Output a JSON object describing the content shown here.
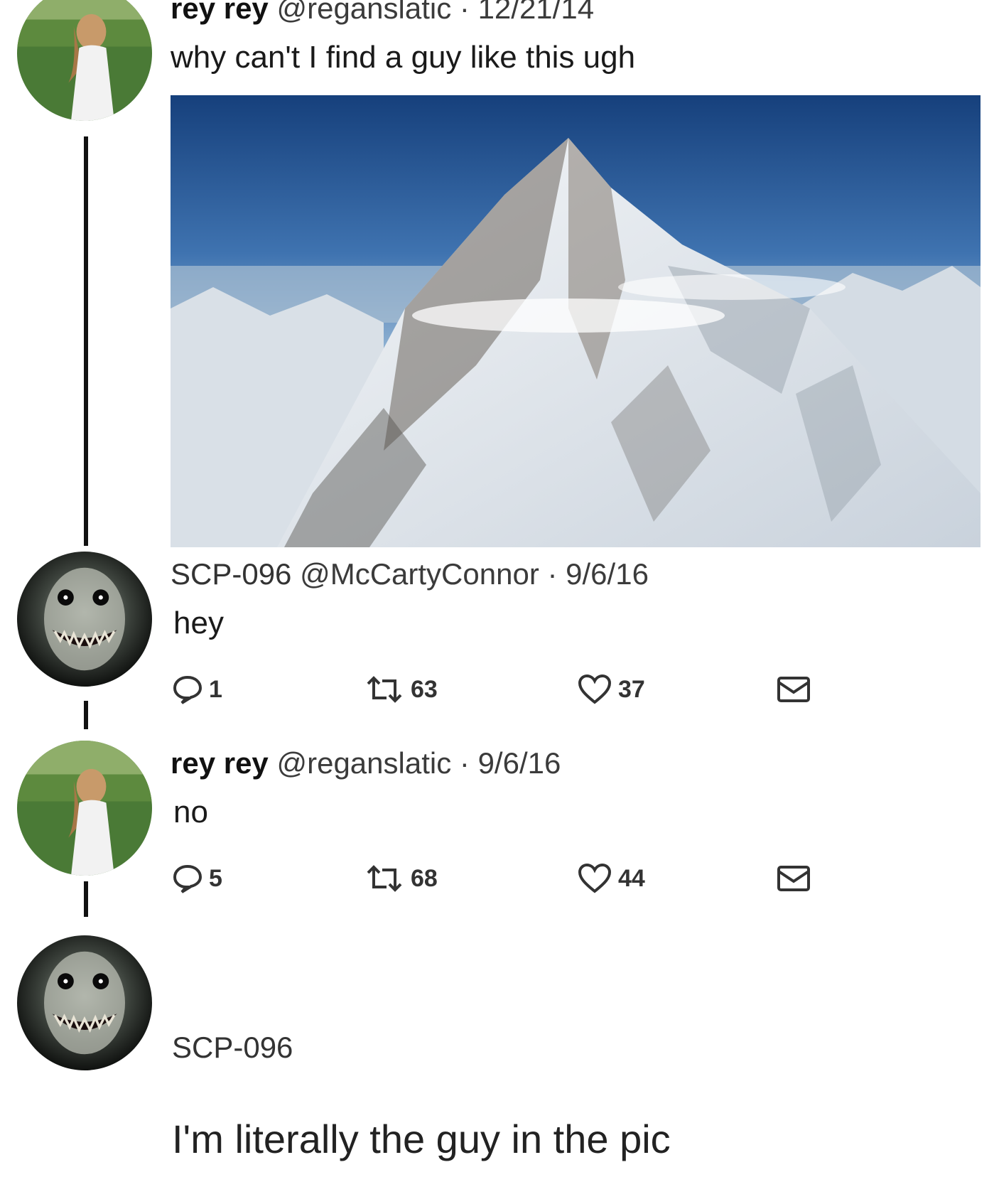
{
  "tweets": [
    {
      "author": "rey rey",
      "handle": "@reganslatic",
      "separator": "·",
      "date": "12/21/14",
      "text": "why can't I find a guy like this ugh",
      "avatar_icon": "girl-field-avatar",
      "image_icon": "mountain-photo"
    },
    {
      "author": "SCP-096",
      "handle": "@McCartyConnor",
      "separator": "·",
      "date": "9/6/16",
      "text": "hey",
      "avatar_icon": "pale-creature-avatar",
      "replies": "1",
      "retweets": "63",
      "likes": "37"
    },
    {
      "author": "rey rey",
      "handle": "@reganslatic",
      "separator": "·",
      "date": "9/6/16",
      "text": "no",
      "avatar_icon": "girl-field-avatar",
      "replies": "5",
      "retweets": "68",
      "likes": "44"
    },
    {
      "author": "SCP-096",
      "text": "I'm literally the guy in the pic",
      "avatar_icon": "pale-creature-avatar"
    }
  ],
  "icons": {
    "reply": "speech-bubble-icon",
    "retweet": "retweet-arrows-icon",
    "like": "heart-icon",
    "message": "envelope-icon"
  },
  "colors": {
    "background": "#ffffff",
    "text": "#1c1c1c",
    "thread_line": "#111111",
    "sky": "#1e4c8a"
  }
}
